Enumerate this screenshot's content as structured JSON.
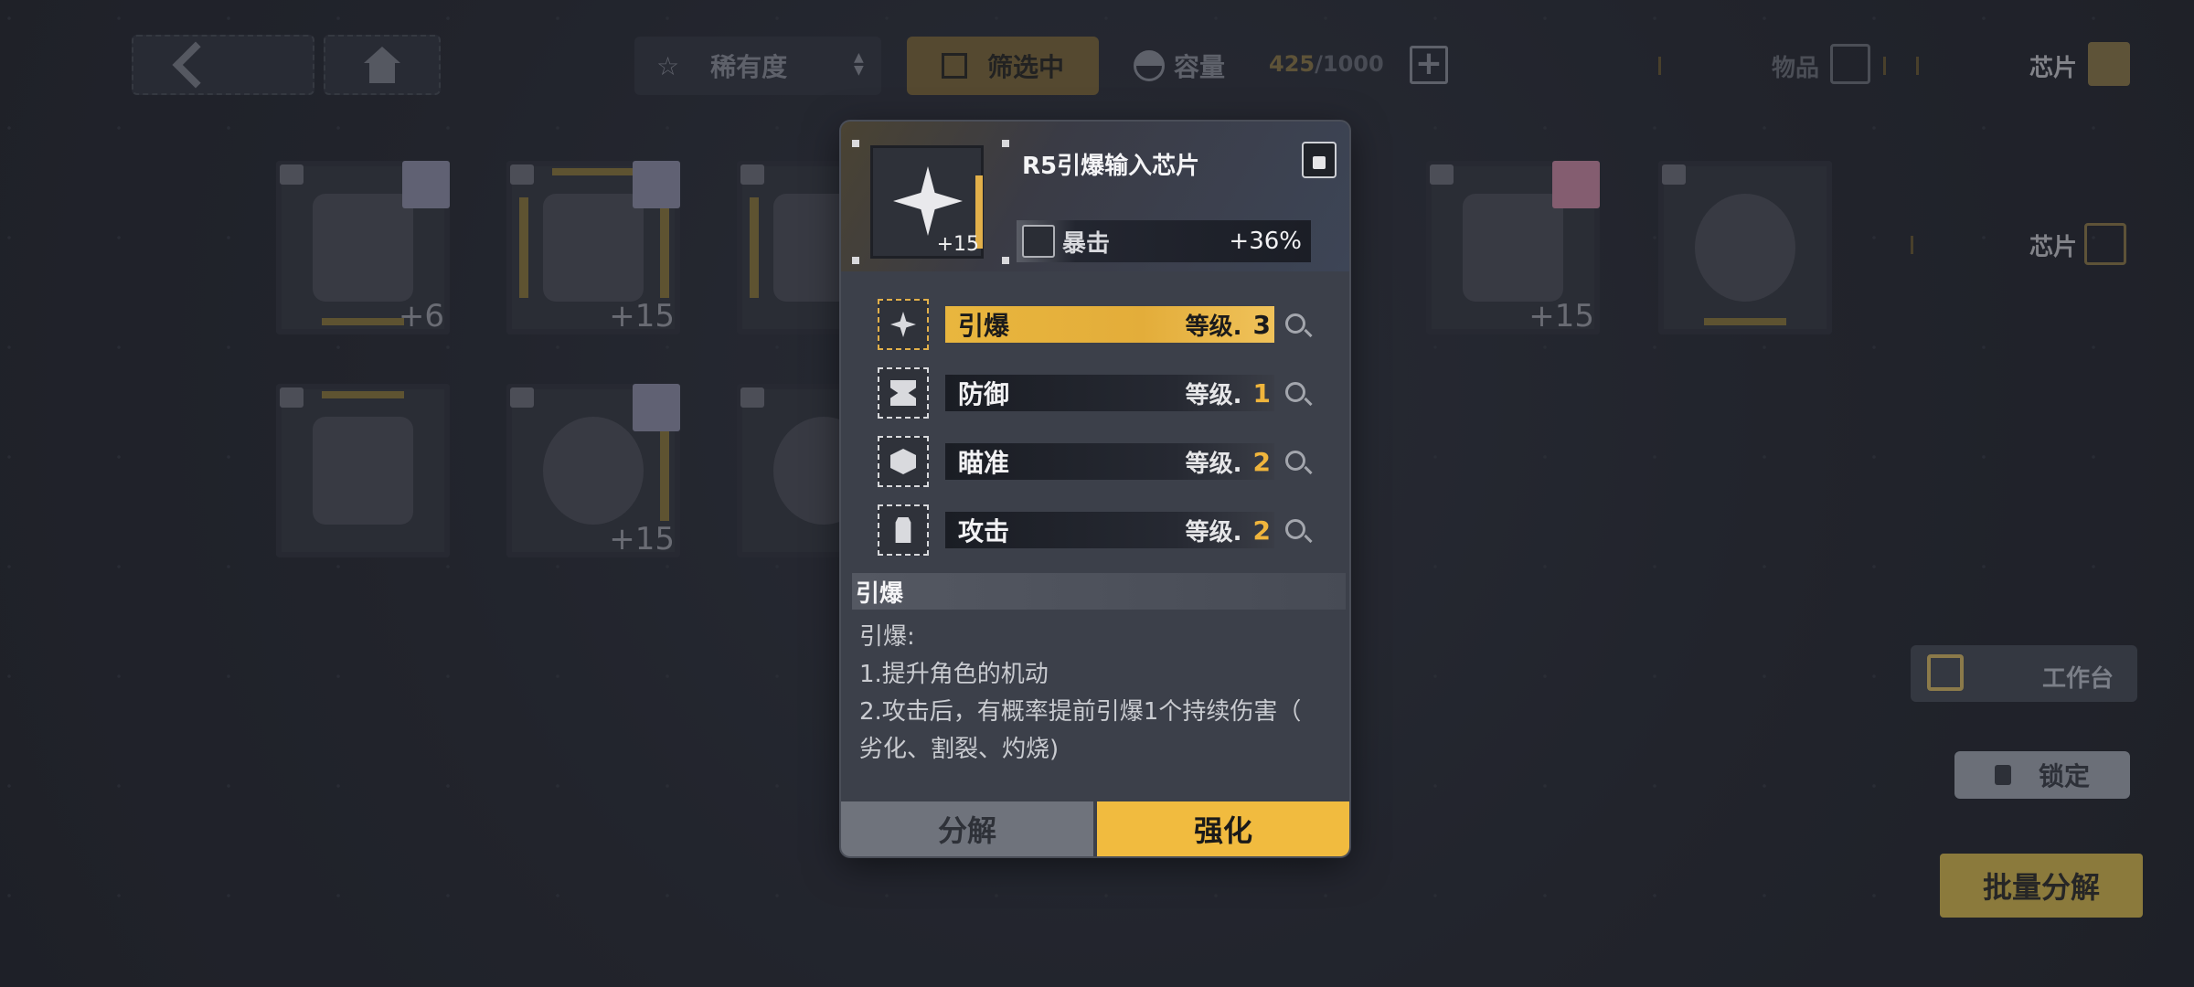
{
  "topbar": {
    "rarity_label": "稀有度",
    "filter_label": "筛选中",
    "capacity_label": "容量",
    "capacity_current": "425",
    "capacity_max": "/1000",
    "tab_items_label": "物品",
    "tab_chips_label": "芯片",
    "subtab_chips_label": "芯片"
  },
  "grid": {
    "chips": [
      {
        "level": "+6"
      },
      {
        "level": "+15"
      },
      {
        "level": ""
      },
      {
        "level": "+15"
      },
      {
        "level": ""
      },
      {
        "level": ""
      },
      {
        "level": "+15"
      },
      {
        "level": ""
      }
    ]
  },
  "side": {
    "workbench_label": "工作台",
    "lock_label": "锁定",
    "bulk_label": "批量分解"
  },
  "popup": {
    "title": "R5引爆输入芯片",
    "icon_level": "+15",
    "stat_name": "暴击",
    "stat_value": "+36%",
    "skills": [
      {
        "name": "引爆",
        "level_label": "等级.",
        "level": "3"
      },
      {
        "name": "防御",
        "level_label": "等级.",
        "level": "1"
      },
      {
        "name": "瞄准",
        "level_label": "等级.",
        "level": "2"
      },
      {
        "name": "攻击",
        "level_label": "等级.",
        "level": "2"
      }
    ],
    "desc_title": "引爆",
    "desc_lines": [
      "引爆:",
      "1.提升角色的机动",
      "2.攻击后，有概率提前引爆1个持续伤害（",
      "劣化、割裂、灼烧)"
    ],
    "split_label": "分解",
    "enhance_label": "强化"
  },
  "colors": {
    "accent_gold": "#f1bb3f",
    "panel": "#3c404a",
    "background": "#2a2e35"
  }
}
